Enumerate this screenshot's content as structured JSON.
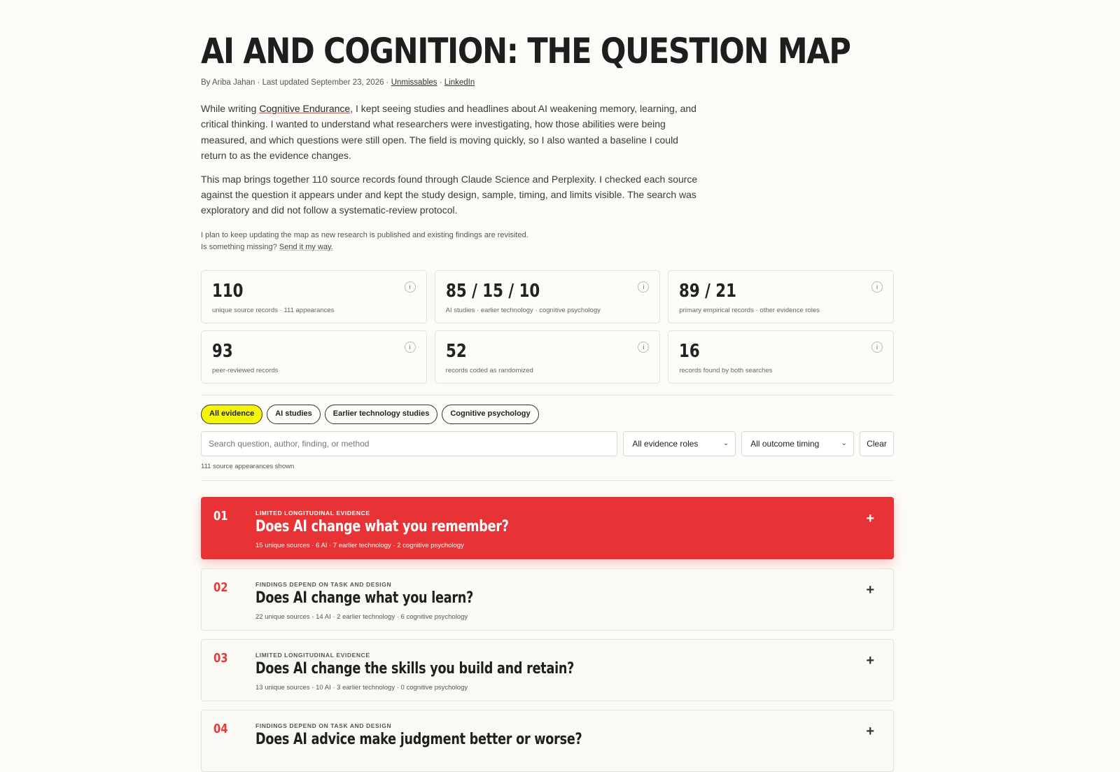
{
  "header": {
    "title": "AI AND COGNITION: THE QUESTION MAP",
    "byline_prefix": "By Ariba Jahan · Last updated September 23, 2026 · ",
    "link_unmissables": "Unmissables",
    "sep": " · ",
    "link_linkedin": "LinkedIn"
  },
  "intro": {
    "p1_before": "While writing ",
    "p1_link": "Cognitive Endurance",
    "p1_after": ", I kept seeing studies and headlines about AI weakening memory, learning, and critical thinking. I wanted to understand what researchers were investigating, how those abilities were being measured, and which questions were still open. The field is moving quickly, so I also wanted a baseline I could return to as the evidence changes.",
    "p2": "This map brings together 110 source records found through Claude Science and Perplexity. I checked each source against the question it appears under and kept the study design, sample, timing, and limits visible. The search was exploratory and did not follow a systematic-review protocol.",
    "note1": "I plan to keep updating the map as new research is published and existing findings are revisited.",
    "note2_before": "Is something missing? ",
    "note2_link": "Send it my way."
  },
  "stats": [
    {
      "num": "110",
      "label": "unique source records · 111 appearances"
    },
    {
      "num": "85 / 15 / 10",
      "label": "AI studies · earlier technology · cognitive psychology"
    },
    {
      "num": "89 / 21",
      "label": "primary empirical records · other evidence roles"
    },
    {
      "num": "93",
      "label": "peer-reviewed records"
    },
    {
      "num": "52",
      "label": "records coded as randomized"
    },
    {
      "num": "16",
      "label": "records found by both searches"
    }
  ],
  "info_glyph": "i",
  "chips": [
    "All evidence",
    "AI studies",
    "Earlier technology studies",
    "Cognitive psychology"
  ],
  "filters": {
    "search_placeholder": "Search question, author, finding, or method",
    "roles": "All evidence roles",
    "timing": "All outcome timing",
    "clear": "Clear",
    "shown": "111 source appearances shown"
  },
  "questions": [
    {
      "n": "01",
      "tag": "LIMITED LONGITUDINAL EVIDENCE",
      "title": "Does AI change what you remember?",
      "meta": "15 unique sources · 6 AI · 7 earlier technology · 2 cognitive psychology"
    },
    {
      "n": "02",
      "tag": "FINDINGS DEPEND ON TASK AND DESIGN",
      "title": "Does AI change what you learn?",
      "meta": "22 unique sources · 14 AI · 2 earlier technology · 6 cognitive psychology"
    },
    {
      "n": "03",
      "tag": "LIMITED LONGITUDINAL EVIDENCE",
      "title": "Does AI change the skills you build and retain?",
      "meta": "13 unique sources · 10 AI · 3 earlier technology · 0 cognitive psychology"
    },
    {
      "n": "04",
      "tag": "FINDINGS DEPEND ON TASK AND DESIGN",
      "title": "Does AI advice make judgment better or worse?",
      "meta": ""
    }
  ],
  "plus_glyph": "+",
  "chevron_glyph": "⌄",
  "colors": {
    "accent": "#e73335",
    "chip_active": "#f4f50a",
    "background": "#fcfbf8"
  }
}
